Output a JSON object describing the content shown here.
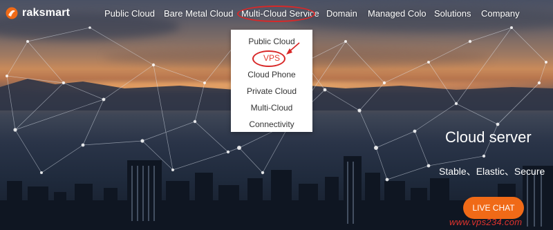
{
  "brand": {
    "name": "raksmart",
    "accent": "#f06a17"
  },
  "nav": {
    "items": [
      {
        "label": "Public Cloud"
      },
      {
        "label": "Bare Metal Cloud"
      },
      {
        "label": "Multi-Cloud Service"
      },
      {
        "label": "Domain"
      },
      {
        "label": "Managed Colo"
      },
      {
        "label": "Solutions"
      },
      {
        "label": "Company"
      }
    ],
    "highlighted_item": "Multi-Cloud Service"
  },
  "dropdown": {
    "items": [
      {
        "label": "Public Cloud"
      },
      {
        "label": "VPS"
      },
      {
        "label": "Cloud Phone"
      },
      {
        "label": "Private Cloud"
      },
      {
        "label": "Multi-Cloud"
      },
      {
        "label": "Connectivity"
      }
    ],
    "active_item": "VPS"
  },
  "hero": {
    "title": "Cloud server",
    "subtitle": "Stable、Elastic、Secure"
  },
  "live_chat": {
    "label": "LIVE CHAT"
  },
  "watermark": {
    "text": "www.vps234.com"
  },
  "annotation_color": "#d82828",
  "icons": [
    "raksmart-logo-icon",
    "annotation-arrow-icon"
  ]
}
